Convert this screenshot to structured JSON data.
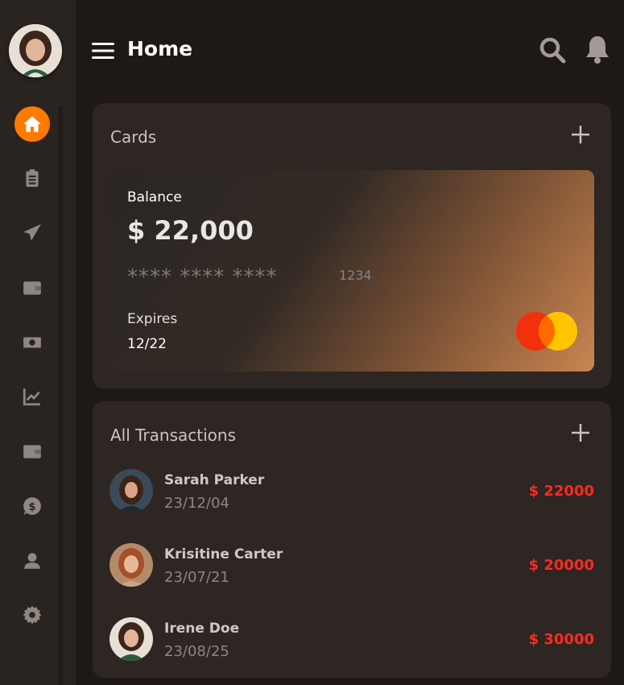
{
  "header": {
    "title": "Home"
  },
  "sidebar": {
    "items": [
      {
        "icon": "home-icon",
        "active": true
      },
      {
        "icon": "clipboard-icon",
        "active": false
      },
      {
        "icon": "send-icon",
        "active": false
      },
      {
        "icon": "wallet-icon",
        "active": false
      },
      {
        "icon": "money-icon",
        "active": false
      },
      {
        "icon": "chart-icon",
        "active": false
      },
      {
        "icon": "wallet-icon",
        "active": false
      },
      {
        "icon": "dollar-chat-icon",
        "active": false
      },
      {
        "icon": "user-icon",
        "active": false
      },
      {
        "icon": "gear-icon",
        "active": false
      }
    ]
  },
  "cards": {
    "title": "Cards",
    "card": {
      "balance_label": "Balance",
      "balance_value": "$ 22,000",
      "masked_number": "**** **** ****",
      "last4": "1234",
      "expires_label": "Expires",
      "expires_value": "12/22",
      "brand_icon": "mastercard-icon"
    }
  },
  "transactions": {
    "title": "All Transactions",
    "items": [
      {
        "name": "Sarah Parker",
        "date": "23/12/04",
        "amount": "$ 22000"
      },
      {
        "name": "Krisitine Carter",
        "date": "23/07/21",
        "amount": "$ 20000"
      },
      {
        "name": "Irene Doe",
        "date": "23/08/25",
        "amount": "$ 30000"
      }
    ]
  },
  "colors": {
    "accent": "#ff7a00",
    "amount": "#ff2a1f",
    "panel": "#2d2623",
    "sidebar": "#2a2421"
  }
}
